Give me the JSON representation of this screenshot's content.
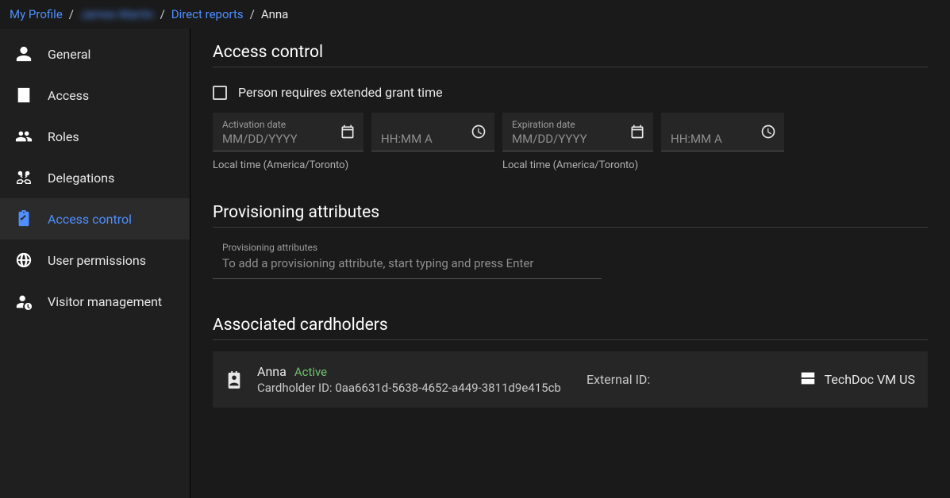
{
  "breadcrumb": {
    "items": [
      {
        "label": "My Profile",
        "link": true
      },
      {
        "label": "James Martin",
        "link": true,
        "blurred": true
      },
      {
        "label": "Direct reports",
        "link": true
      },
      {
        "label": "Anna",
        "link": false
      }
    ]
  },
  "sidebar": {
    "items": [
      {
        "id": "general",
        "label": "General",
        "icon": "person-icon"
      },
      {
        "id": "access",
        "label": "Access",
        "icon": "building-icon"
      },
      {
        "id": "roles",
        "label": "Roles",
        "icon": "group-icon"
      },
      {
        "id": "delegations",
        "label": "Delegations",
        "icon": "swap-icon"
      },
      {
        "id": "access-control",
        "label": "Access control",
        "icon": "clipboard-icon",
        "active": true
      },
      {
        "id": "user-permissions",
        "label": "User permissions",
        "icon": "globe-icon"
      },
      {
        "id": "visitor-management",
        "label": "Visitor management",
        "icon": "person-clock-icon"
      }
    ]
  },
  "sections": {
    "access_control": {
      "title": "Access control",
      "extended_grant_label": "Person requires extended grant time",
      "extended_grant_checked": false,
      "activation": {
        "label": "Activation date",
        "placeholder": "MM/DD/YYYY",
        "time_placeholder": "HH:MM A",
        "helper": "Local time (America/Toronto)",
        "value": "",
        "time_value": ""
      },
      "expiration": {
        "label": "Expiration date",
        "placeholder": "MM/DD/YYYY",
        "time_placeholder": "HH:MM A",
        "helper": "Local time (America/Toronto)",
        "value": "",
        "time_value": ""
      }
    },
    "provisioning": {
      "title": "Provisioning attributes",
      "field_label": "Provisioning attributes",
      "placeholder": "To add a provisioning attribute, start typing and press Enter",
      "value": ""
    },
    "cardholders": {
      "title": "Associated cardholders",
      "items": [
        {
          "name": "Anna",
          "status": "Active",
          "cardholder_id_label": "Cardholder ID:",
          "cardholder_id": "0aa6631d-5638-4652-a449-3811d9e415cb",
          "external_id_label": "External ID:",
          "external_id": "",
          "system": "TechDoc VM US"
        }
      ]
    }
  }
}
